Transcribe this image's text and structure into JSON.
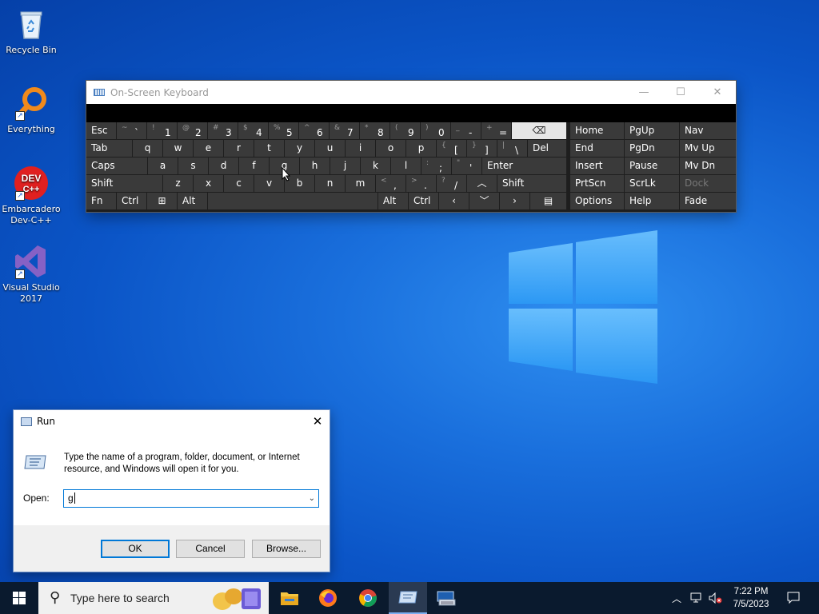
{
  "desktop": {
    "icons": [
      {
        "label": "Recycle Bin"
      },
      {
        "label": "Everything"
      },
      {
        "label": "Embarcadero Dev-C++"
      },
      {
        "label": "Visual Studio 2017"
      }
    ]
  },
  "osk": {
    "title": "On-Screen Keyboard",
    "row1": [
      {
        "label": "Esc"
      },
      {
        "sub": "~",
        "main": "`"
      },
      {
        "sub": "!",
        "main": "1"
      },
      {
        "sub": "@",
        "main": "2"
      },
      {
        "sub": "#",
        "main": "3"
      },
      {
        "sub": "$",
        "main": "4"
      },
      {
        "sub": "%",
        "main": "5"
      },
      {
        "sub": "^",
        "main": "6"
      },
      {
        "sub": "&",
        "main": "7"
      },
      {
        "sub": "*",
        "main": "8"
      },
      {
        "sub": "(",
        "main": "9"
      },
      {
        "sub": ")",
        "main": "0"
      },
      {
        "sub": "_",
        "main": "-"
      },
      {
        "sub": "+",
        "main": "="
      }
    ],
    "row2": [
      "Tab",
      "q",
      "w",
      "e",
      "r",
      "t",
      "y",
      "u",
      "i",
      "o",
      "p"
    ],
    "row2_sym": [
      {
        "sub": "{",
        "main": "["
      },
      {
        "sub": "}",
        "main": "]"
      },
      {
        "sub": "|",
        "main": "\\"
      }
    ],
    "row2_del": "Del",
    "row3": [
      "Caps",
      "a",
      "s",
      "d",
      "f",
      "g",
      "h",
      "j",
      "k",
      "l"
    ],
    "row3_sym": [
      {
        "sub": ":",
        "main": ";"
      },
      {
        "sub": "\"",
        "main": "'"
      }
    ],
    "row3_enter": "Enter",
    "row4": [
      "Shift",
      "z",
      "x",
      "c",
      "v",
      "b",
      "n",
      "m"
    ],
    "row4_sym": [
      {
        "sub": "<",
        "main": ","
      },
      {
        "sub": ">",
        "main": "."
      },
      {
        "sub": "?",
        "main": "/"
      }
    ],
    "row4_shift2": "Shift",
    "row5": {
      "fn": "Fn",
      "ctrl": "Ctrl",
      "alt": "Alt",
      "alt2": "Alt",
      "ctrl2": "Ctrl"
    },
    "nav": {
      "home": "Home",
      "pgup": "PgUp",
      "nav": "Nav",
      "end": "End",
      "pgdn": "PgDn",
      "mvup": "Mv Up",
      "insert": "Insert",
      "pause": "Pause",
      "mvdn": "Mv Dn",
      "prtscn": "PrtScn",
      "scrlk": "ScrLk",
      "dock": "Dock",
      "options": "Options",
      "help": "Help",
      "fade": "Fade"
    }
  },
  "run": {
    "title": "Run",
    "description": "Type the name of a program, folder, document, or Internet resource, and Windows will open it for you.",
    "open_label": "Open:",
    "open_value": "g",
    "ok": "OK",
    "cancel": "Cancel",
    "browse": "Browse..."
  },
  "taskbar": {
    "search_placeholder": "Type here to search",
    "time": "7:22 PM",
    "date": "7/5/2023"
  }
}
